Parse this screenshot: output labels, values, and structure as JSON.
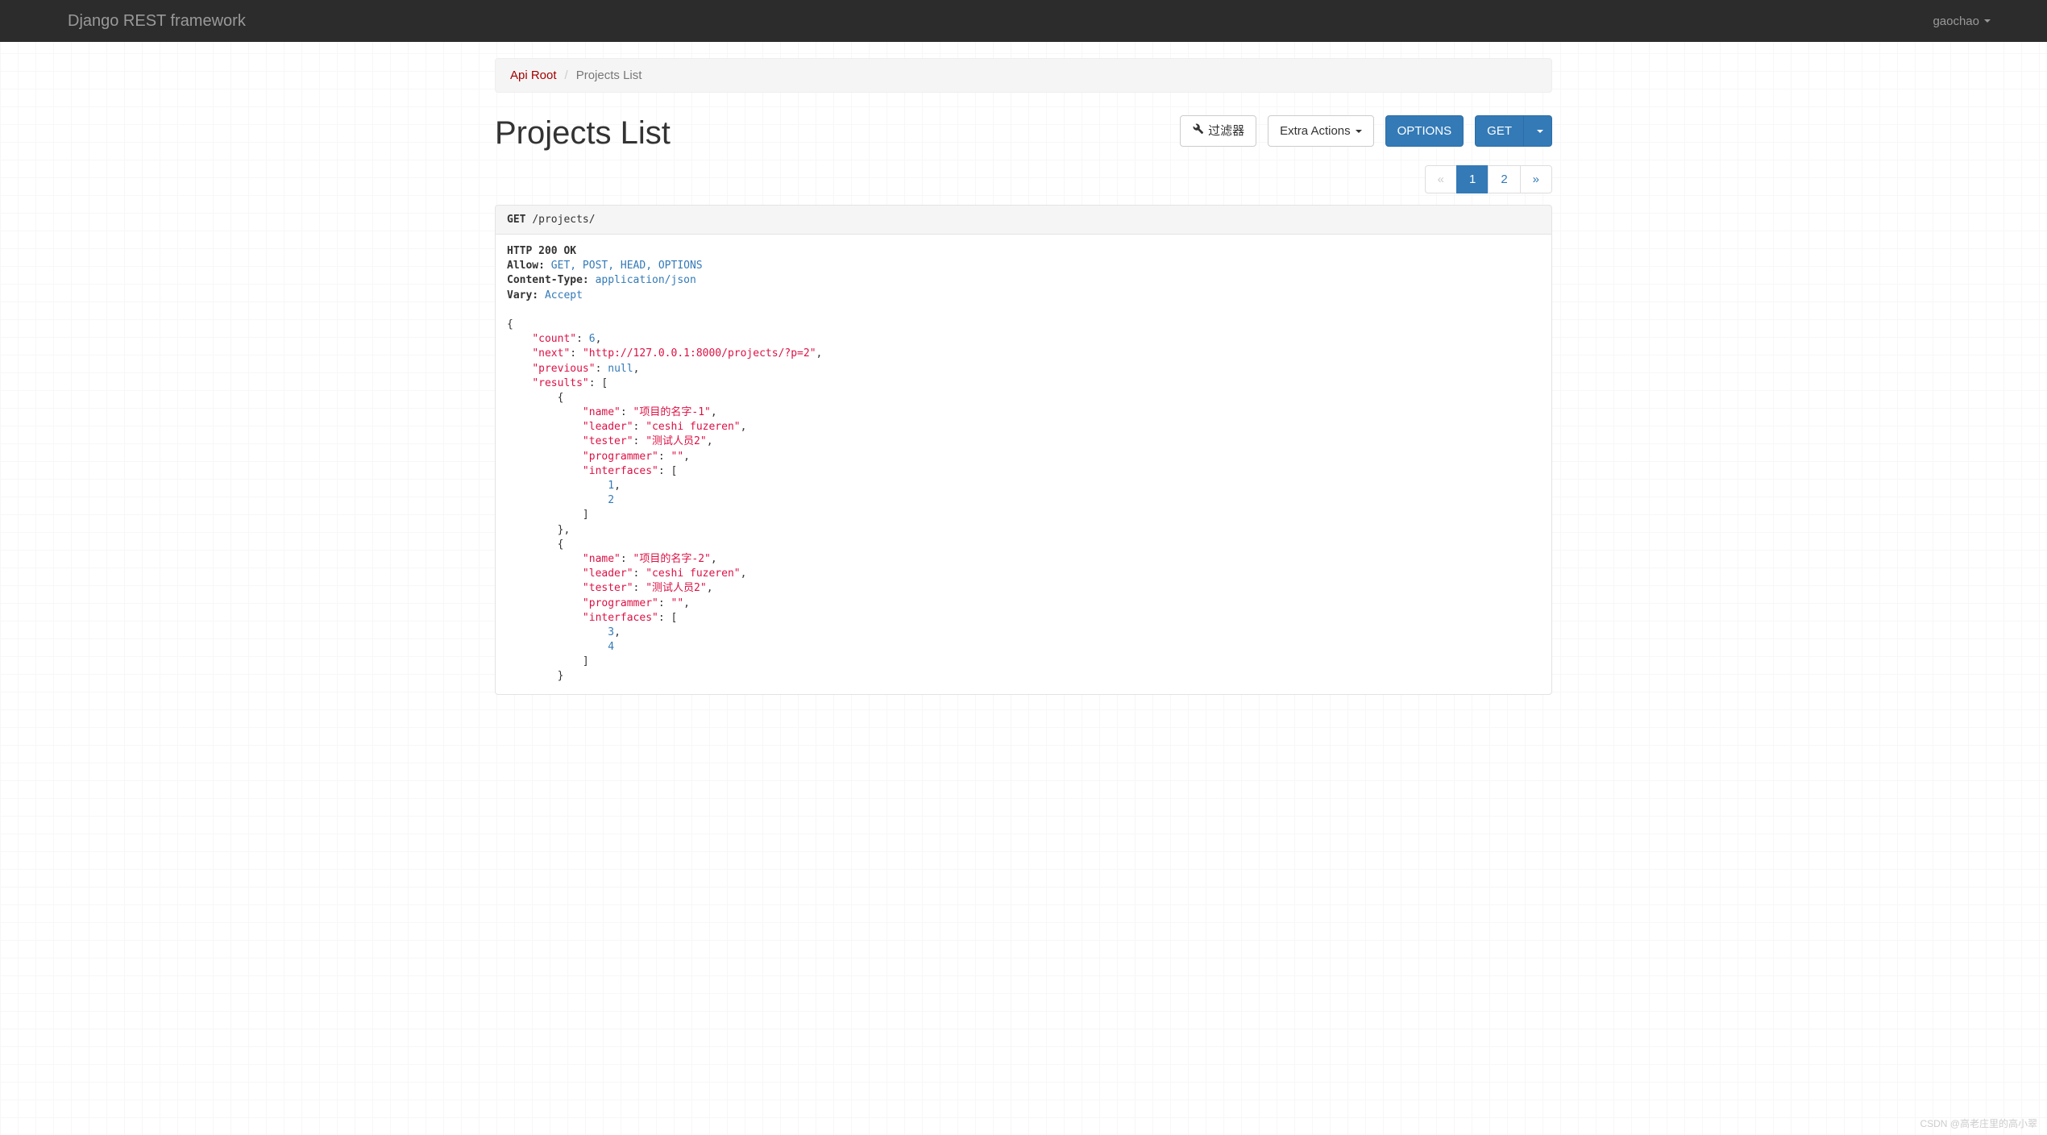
{
  "navbar": {
    "brand": "Django REST framework",
    "user": "gaochao"
  },
  "breadcrumb": [
    {
      "label": "Api Root",
      "active": false
    },
    {
      "label": "Projects List",
      "active": true
    }
  ],
  "title": "Projects List",
  "toolbar": {
    "filter": "过滤器",
    "extra_actions": "Extra Actions",
    "options": "OPTIONS",
    "get": "GET"
  },
  "pagination": [
    "«",
    "1",
    "2",
    "»"
  ],
  "request": {
    "method": "GET",
    "path": "/projects/"
  },
  "response": {
    "status_line": "HTTP 200 OK",
    "headers": {
      "Allow": "GET, POST, HEAD, OPTIONS",
      "Content-Type": "application/json",
      "Vary": "Accept"
    },
    "body": {
      "count": 6,
      "next": "http://127.0.0.1:8000/projects/?p=2",
      "previous": null,
      "results": [
        {
          "name": "项目的名字-1",
          "leader": "ceshi fuzeren",
          "tester": "测试人员2",
          "programmer": "",
          "interfaces": [
            1,
            2
          ]
        },
        {
          "name": "项目的名字-2",
          "leader": "ceshi fuzeren",
          "tester": "测试人员2",
          "programmer": "",
          "interfaces": [
            3,
            4
          ]
        }
      ]
    }
  },
  "watermark": "CSDN @高老庄里的高小翠"
}
